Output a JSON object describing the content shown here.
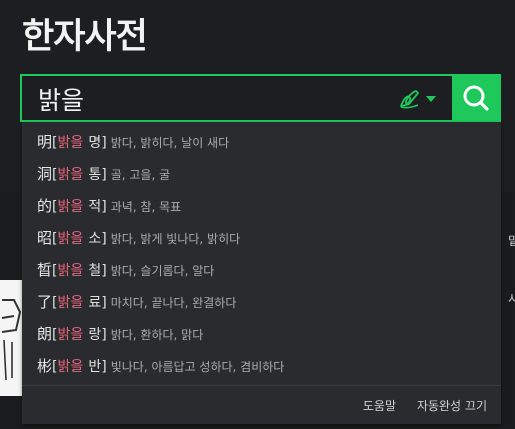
{
  "app": {
    "title": "한자사전"
  },
  "search": {
    "value": "밝을"
  },
  "suggestions": [
    {
      "hanja": "明",
      "highlight": "밝을",
      "reading": "명",
      "meaning": "밝다, 밝히다, 날이 새다"
    },
    {
      "hanja": "洞",
      "highlight": "밝을",
      "reading": "통",
      "meaning": "골, 고을, 굴"
    },
    {
      "hanja": "的",
      "highlight": "밝을",
      "reading": "적",
      "meaning": "과녁, 참, 목표"
    },
    {
      "hanja": "昭",
      "highlight": "밝을",
      "reading": "소",
      "meaning": "밝다, 밝게 빛나다, 밝히다"
    },
    {
      "hanja": "晳",
      "highlight": "밝을",
      "reading": "철",
      "meaning": "밝다, 슬기롭다, 알다"
    },
    {
      "hanja": "了",
      "highlight": "밝을",
      "reading": "료",
      "meaning": "마치다, 끝나다, 완결하다"
    },
    {
      "hanja": "朗",
      "highlight": "밝을",
      "reading": "랑",
      "meaning": "밝다, 환하다, 맑다"
    },
    {
      "hanja": "彬",
      "highlight": "밝을",
      "reading": "반",
      "meaning": "빛나다, 아름답고 성하다, 겸비하다"
    }
  ],
  "dropdown_footer": {
    "help": "도움말",
    "autocomplete_off": "자동완성 끄기"
  },
  "edge_glyphs": [
    "밑",
    "시"
  ],
  "icons": {
    "search": "search-icon",
    "handwriting": "handwriting-pen-icon",
    "dropdown": "caret-down-icon"
  },
  "colors": {
    "accent": "#1ec85a",
    "highlight": "#e6677a",
    "background": "#1d1e22",
    "dropdown_bg": "#2a2b2f"
  }
}
